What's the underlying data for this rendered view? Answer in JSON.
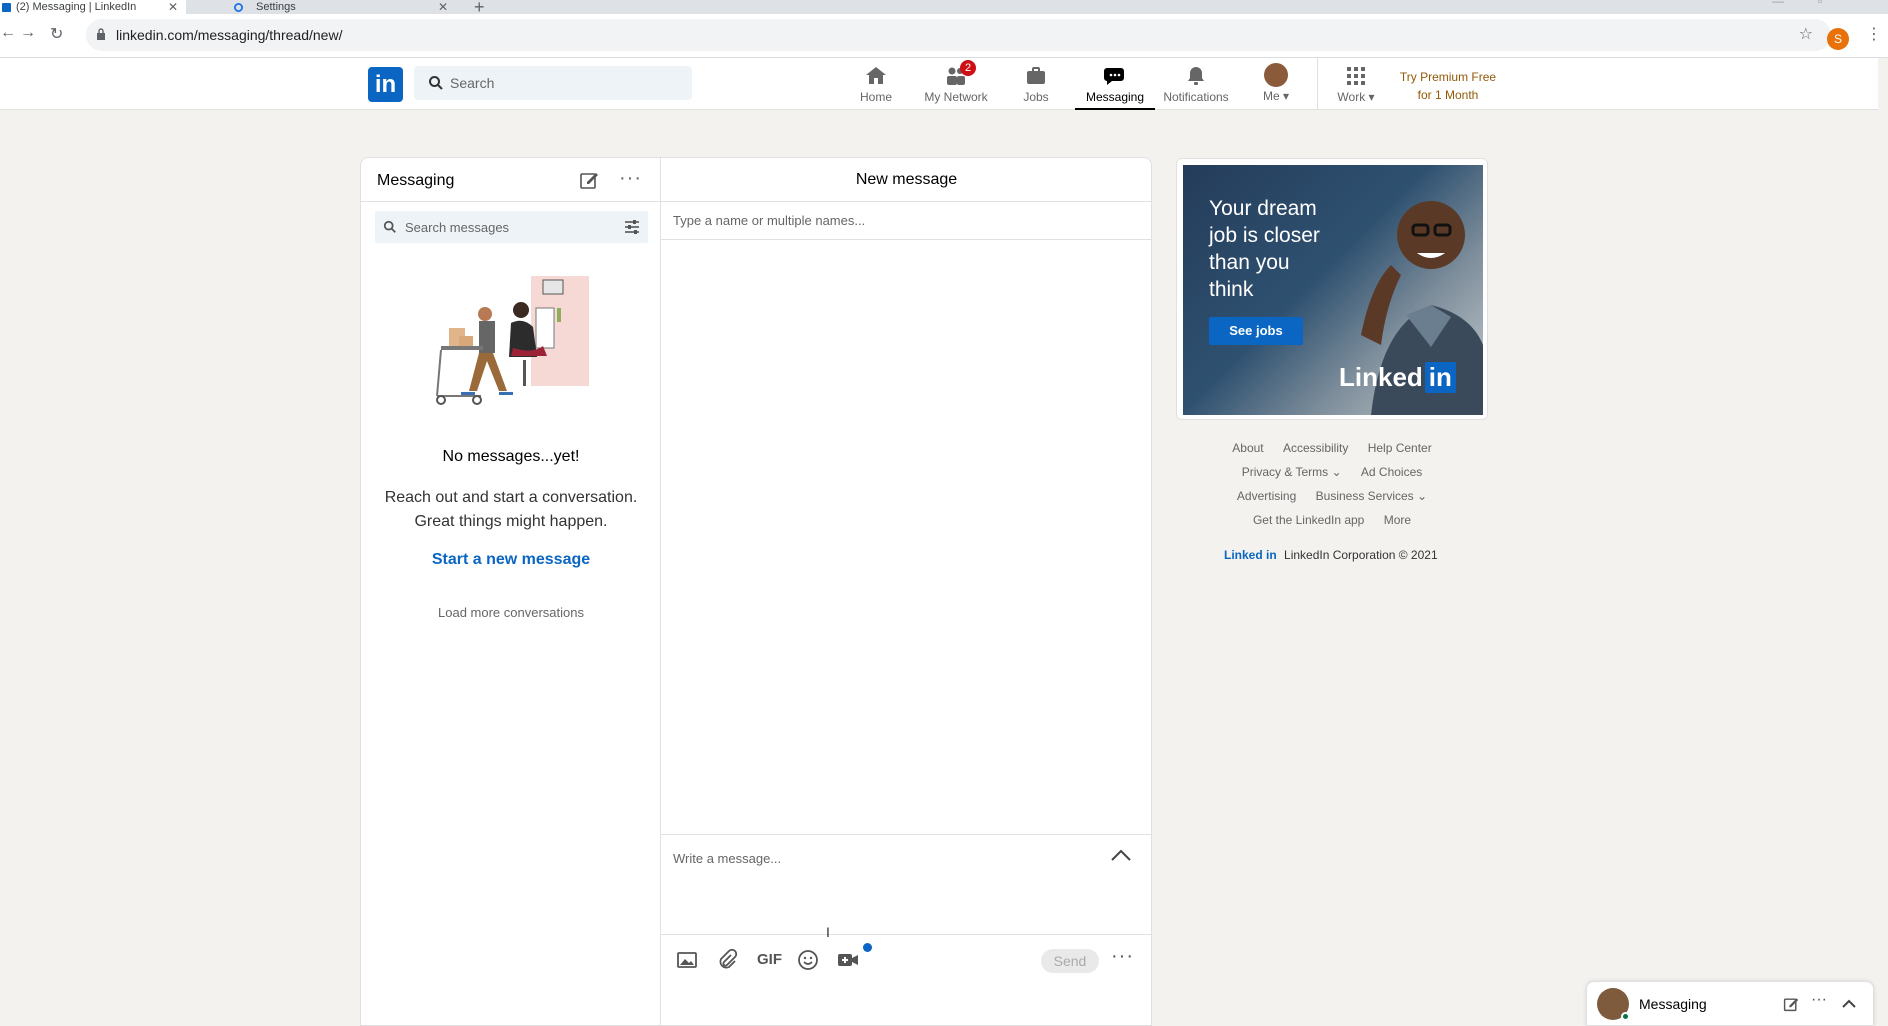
{
  "browser": {
    "tabs": [
      {
        "title": "(2) Messaging | LinkedIn",
        "active": true
      },
      {
        "title": "Settings",
        "active": false
      }
    ],
    "url": "linkedin.com/messaging/thread/new/",
    "profile_initial": "S",
    "new_tab_symbol": "+",
    "close_symbol": "✕"
  },
  "nav": {
    "search_placeholder": "Search",
    "items": [
      {
        "label": "Home",
        "icon": "home-icon"
      },
      {
        "label": "My Network",
        "icon": "network-icon",
        "badge": "2"
      },
      {
        "label": "Jobs",
        "icon": "briefcase-icon"
      },
      {
        "label": "Messaging",
        "icon": "messaging-icon",
        "active": true
      },
      {
        "label": "Notifications",
        "icon": "bell-icon"
      },
      {
        "label": "Me",
        "icon": "avatar"
      },
      {
        "label": "Work",
        "icon": "grid-icon"
      }
    ],
    "premium_line1": "Try Premium Free",
    "premium_line2": "for 1 Month"
  },
  "messaging": {
    "title": "Messaging",
    "search_placeholder": "Search messages",
    "empty_title": "No messages...yet!",
    "empty_desc_line1": "Reach out and start a conversation.",
    "empty_desc_line2": "Great things might happen.",
    "start_link": "Start a new message",
    "load_more": "Load more conversations"
  },
  "compose": {
    "header": "New message",
    "to_placeholder": "Type a name or multiple names...",
    "body_placeholder": "Write a message...",
    "gif_label": "GIF",
    "send_label": "Send"
  },
  "ad": {
    "headline": "Your dream job is closer than you think",
    "cta": "See jobs",
    "logo_text": "Linked",
    "logo_in": "in"
  },
  "footer": {
    "row1": [
      "About",
      "Accessibility",
      "Help Center"
    ],
    "row2": [
      "Privacy & Terms ⌄",
      "Ad Choices"
    ],
    "row3": [
      "Advertising",
      "Business Services ⌄"
    ],
    "row4": [
      "Get the LinkedIn app",
      "More"
    ],
    "brand": "Linked in",
    "copyright": "LinkedIn Corporation © 2021"
  },
  "overlay": {
    "title": "Messaging"
  },
  "colors": {
    "brand": "#0a66c2",
    "premium": "#915907",
    "badge": "#cc1016"
  }
}
